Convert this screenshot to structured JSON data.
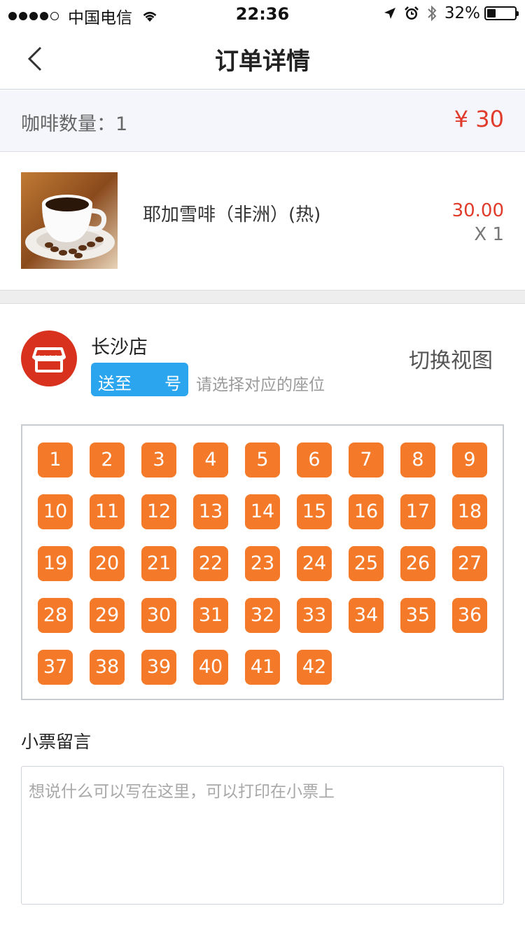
{
  "status_bar": {
    "carrier": "中国电信",
    "time": "22:36",
    "battery": "32%"
  },
  "nav": {
    "title": "订单详情"
  },
  "summary": {
    "label": "咖啡数量：1",
    "total": "¥ 30"
  },
  "product": {
    "name": "耶加雪啡（非洲）(热)",
    "price": "30.00",
    "quantity": "X 1"
  },
  "store": {
    "name": "长沙店",
    "deliver_prefix": "送至",
    "deliver_suffix": "号",
    "seat_hint": "请选择对应的座位",
    "switch_view": "切换视图"
  },
  "seats": [
    "1",
    "2",
    "3",
    "4",
    "5",
    "6",
    "7",
    "8",
    "9",
    "10",
    "11",
    "12",
    "13",
    "14",
    "15",
    "16",
    "17",
    "18",
    "19",
    "20",
    "21",
    "22",
    "23",
    "24",
    "25",
    "26",
    "27",
    "28",
    "29",
    "30",
    "31",
    "32",
    "33",
    "34",
    "35",
    "36",
    "37",
    "38",
    "39",
    "40",
    "41",
    "42"
  ],
  "ticket": {
    "label": "小票留言",
    "placeholder": "想说什么可以写在这里，可以打印在小票上"
  },
  "colors": {
    "accent_red": "#e03b2b",
    "seat_orange": "#f47a2a",
    "pill_blue": "#2ba6ee",
    "logo_red": "#d8321f"
  }
}
